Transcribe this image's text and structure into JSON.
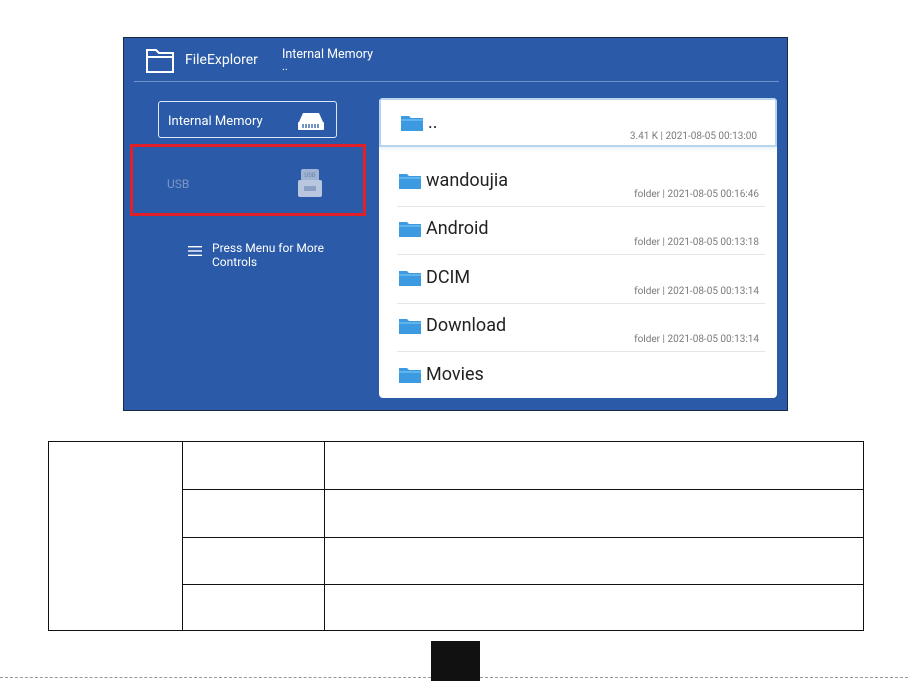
{
  "app": {
    "title": "FileExplorer",
    "breadcrumb_title": "Internal Memory",
    "breadcrumb_path": ".."
  },
  "sidebar": {
    "internal_memory_label": "Internal Memory",
    "usb_label": "USB",
    "menu_hint": "Press Menu for More Controls"
  },
  "files": [
    {
      "name": "..",
      "meta": "3.41 K | 2021-08-05 00:13:00"
    },
    {
      "name": "wandoujia",
      "meta": "folder | 2021-08-05 00:16:46"
    },
    {
      "name": "Android",
      "meta": "folder | 2021-08-05 00:13:18"
    },
    {
      "name": "DCIM",
      "meta": "folder | 2021-08-05 00:13:14"
    },
    {
      "name": "Download",
      "meta": "folder | 2021-08-05 00:13:14"
    },
    {
      "name": "Movies",
      "meta": ""
    }
  ],
  "colors": {
    "screen_bg": "#2a5aa8",
    "highlight": "#e2202a",
    "folder": "#3c9be0"
  }
}
